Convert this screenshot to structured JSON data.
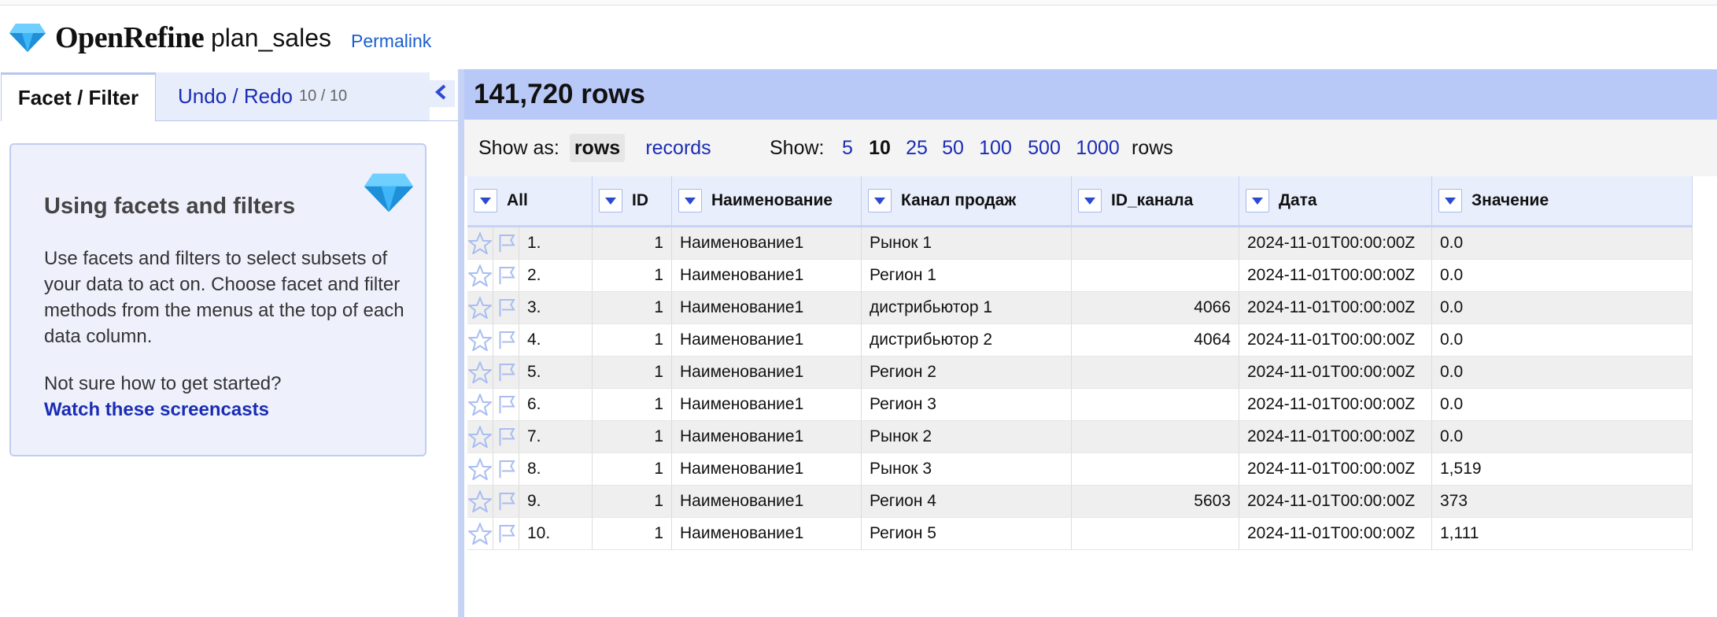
{
  "app": {
    "name": "OpenRefine",
    "project": "plan_sales",
    "permalink": "Permalink"
  },
  "left_panel": {
    "tabs": [
      {
        "label": "Facet / Filter"
      },
      {
        "label": "Undo / Redo",
        "count": "10 / 10"
      }
    ],
    "help": {
      "title": "Using facets and filters",
      "body": "Use facets and filters to select subsets of your data to act on. Choose facet and filter methods from the menus at the top of each data column.",
      "question": "Not sure how to get started?",
      "link": "Watch these screencasts"
    }
  },
  "grid": {
    "rows_count": "141,720 rows",
    "show_as_label": "Show as:",
    "show_as_rows": "rows",
    "show_as_records": "records",
    "show_label": "Show:",
    "page_sizes": [
      "5",
      "10",
      "25",
      "50",
      "100",
      "500",
      "1000"
    ],
    "selected_page_size": "10",
    "rows_suffix": "rows",
    "columns": [
      "All",
      "ID",
      "Наименование",
      "Канал продаж",
      "ID_канала",
      "Дата",
      "Значение"
    ],
    "rows": [
      {
        "num": "1.",
        "id": "1",
        "name": "Наименование1",
        "channel": "Рынок 1",
        "channel_id": "",
        "date": "2024-11-01T00:00:00Z",
        "value": "0.0"
      },
      {
        "num": "2.",
        "id": "1",
        "name": "Наименование1",
        "channel": "Регион 1",
        "channel_id": "",
        "date": "2024-11-01T00:00:00Z",
        "value": "0.0"
      },
      {
        "num": "3.",
        "id": "1",
        "name": "Наименование1",
        "channel": "дистрибьютор 1",
        "channel_id": "4066",
        "date": "2024-11-01T00:00:00Z",
        "value": "0.0"
      },
      {
        "num": "4.",
        "id": "1",
        "name": "Наименование1",
        "channel": "дистрибьютор 2",
        "channel_id": "4064",
        "date": "2024-11-01T00:00:00Z",
        "value": "0.0"
      },
      {
        "num": "5.",
        "id": "1",
        "name": "Наименование1",
        "channel": "Регион 2",
        "channel_id": "",
        "date": "2024-11-01T00:00:00Z",
        "value": "0.0"
      },
      {
        "num": "6.",
        "id": "1",
        "name": "Наименование1",
        "channel": "Регион 3",
        "channel_id": "",
        "date": "2024-11-01T00:00:00Z",
        "value": "0.0"
      },
      {
        "num": "7.",
        "id": "1",
        "name": "Наименование1",
        "channel": "Рынок 2",
        "channel_id": "",
        "date": "2024-11-01T00:00:00Z",
        "value": "0.0"
      },
      {
        "num": "8.",
        "id": "1",
        "name": "Наименование1",
        "channel": "Рынок 3",
        "channel_id": "",
        "date": "2024-11-01T00:00:00Z",
        "value": "1,519"
      },
      {
        "num": "9.",
        "id": "1",
        "name": "Наименование1",
        "channel": "Регион 4",
        "channel_id": "5603",
        "date": "2024-11-01T00:00:00Z",
        "value": "373"
      },
      {
        "num": "10.",
        "id": "1",
        "name": "Наименование1",
        "channel": "Регион 5",
        "channel_id": "",
        "date": "2024-11-01T00:00:00Z",
        "value": "1,111"
      }
    ]
  },
  "colors": {
    "accent_blue": "#1a2db4",
    "header_band": "#b8c9f8",
    "numeric_green": "#207a20"
  },
  "icons": {
    "logo": "diamond-icon",
    "collapse": "chevron-left-icon",
    "star": "star-icon",
    "flag": "flag-icon",
    "column_menu": "dropdown-arrow-icon"
  }
}
